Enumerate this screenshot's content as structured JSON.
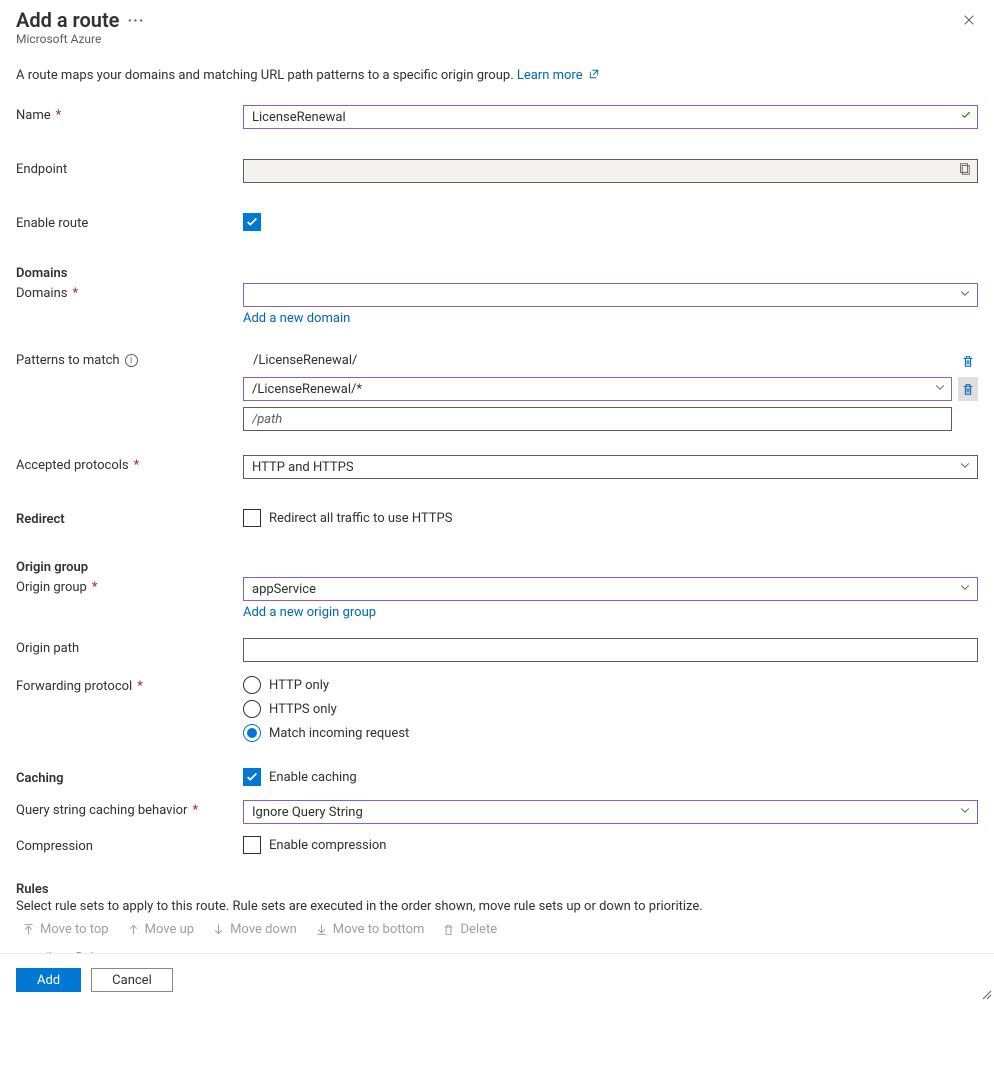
{
  "header": {
    "title": "Add a route",
    "subtitle": "Microsoft Azure"
  },
  "description": {
    "text": "A route maps your domains and matching URL path patterns to a specific origin group. ",
    "link": "Learn more"
  },
  "labels": {
    "name": "Name",
    "endpoint": "Endpoint",
    "enable_route": "Enable route",
    "domains_section": "Domains",
    "domains": "Domains",
    "add_domain": "Add a new domain",
    "patterns": "Patterns to match",
    "accepted_protocols": "Accepted protocols",
    "redirect": "Redirect",
    "redirect_cb": "Redirect all traffic to use HTTPS",
    "origin_group_section": "Origin group",
    "origin_group": "Origin group",
    "add_origin_group": "Add a new origin group",
    "origin_path": "Origin path",
    "forwarding_protocol": "Forwarding protocol",
    "caching": "Caching",
    "enable_caching": "Enable caching",
    "query_string": "Query string caching behavior",
    "compression": "Compression",
    "enable_compression": "Enable compression",
    "rules_section": "Rules",
    "rules_desc": "Select rule sets to apply to this route. Rule sets are executed in the order shown, move rule sets up or down to prioritize."
  },
  "values": {
    "name": "LicenseRenewal",
    "domains": "",
    "pattern_static": "/LicenseRenewal/",
    "pattern_selected": "/LicenseRenewal/*",
    "pattern_placeholder": "/path",
    "accepted_protocols": "HTTP and HTTPS",
    "origin_group": "appService",
    "origin_path": "",
    "query_string": "Ignore Query String"
  },
  "forwarding_protocol_options": {
    "http": "HTTP only",
    "https": "HTTPS only",
    "match": "Match incoming request"
  },
  "toolbar": {
    "move_top": "Move to top",
    "move_up": "Move up",
    "move_down": "Move down",
    "move_bottom": "Move to bottom",
    "delete": "Delete"
  },
  "rules_table": {
    "col_num": "#.",
    "col_ruleset": "Rule set"
  },
  "footer": {
    "add": "Add",
    "cancel": "Cancel"
  }
}
